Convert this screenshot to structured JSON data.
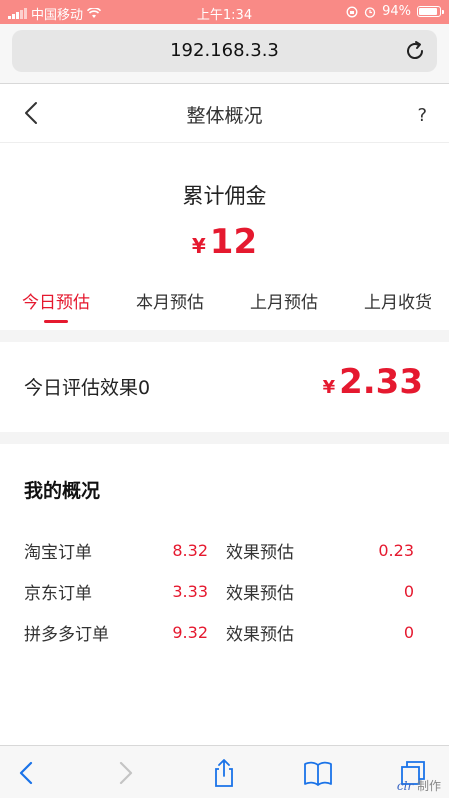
{
  "status_bar": {
    "carrier": "中国移动",
    "time": "上午1:34",
    "battery": "94%",
    "battery_level": 0.94
  },
  "browser": {
    "url": "192.168.3.3"
  },
  "nav": {
    "title": "整体概况",
    "help": "?"
  },
  "summary": {
    "title": "累计佣金",
    "currency": "¥",
    "amount": "12"
  },
  "tabs": [
    {
      "label": "今日预估",
      "active": true
    },
    {
      "label": "本月预估",
      "active": false
    },
    {
      "label": "上月预估",
      "active": false
    },
    {
      "label": "上月收货",
      "active": false
    }
  ],
  "estimate": {
    "label": "今日评估效果0",
    "currency": "¥",
    "value": "2.33"
  },
  "overview": {
    "title": "我的概况",
    "rows": [
      {
        "label": "淘宝订单",
        "value": "8.32",
        "label2": "效果预估",
        "value2": "0.23"
      },
      {
        "label": "京东订单",
        "value": "3.33",
        "label2": "效果预估",
        "value2": "0"
      },
      {
        "label": "拼多多订单",
        "value": "9.32",
        "label2": "效果预估",
        "value2": "0"
      }
    ]
  },
  "watermark": "制作"
}
